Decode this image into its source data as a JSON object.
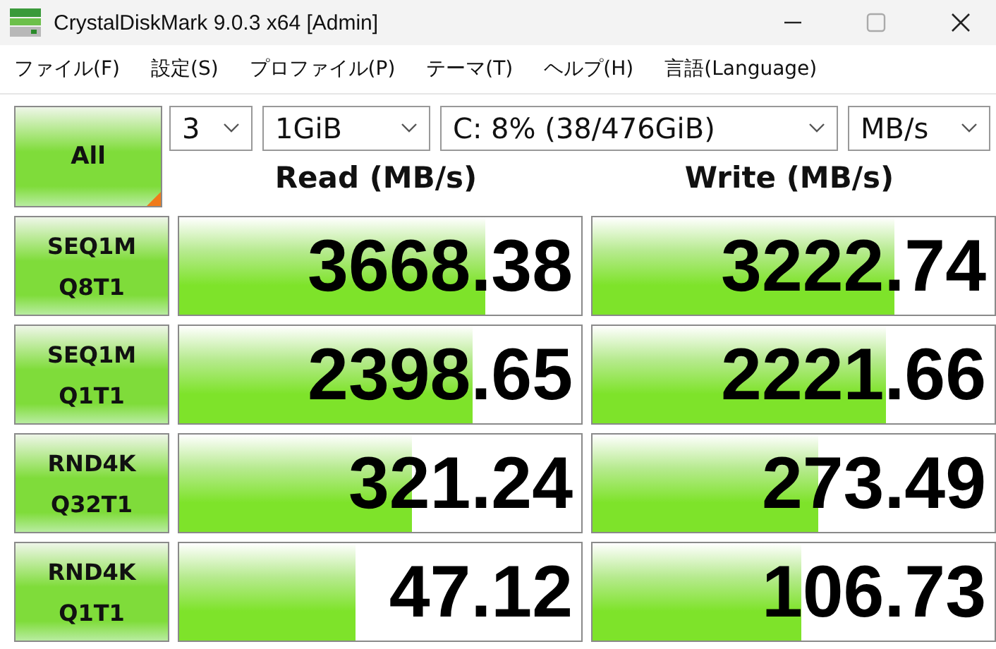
{
  "window": {
    "title": "CrystalDiskMark 9.0.3 x64 [Admin]"
  },
  "menu": [
    "ファイル(F)",
    "設定(S)",
    "プロファイル(P)",
    "テーマ(T)",
    "ヘルプ(H)",
    "言語(Language)"
  ],
  "all_button": {
    "label": "All"
  },
  "selectors": [
    {
      "value": "3"
    },
    {
      "value": "1GiB"
    },
    {
      "value": "C: 8% (38/476GiB)"
    },
    {
      "value": "MB/s"
    }
  ],
  "headers": [
    "Read (MB/s)",
    "Write (MB/s)"
  ],
  "tests": [
    {
      "line1": "SEQ1M",
      "line2": "Q8T1",
      "read": {
        "value": "3668.38",
        "level": 0.76
      },
      "write": {
        "value": "3222.74",
        "level": 0.75
      }
    },
    {
      "line1": "SEQ1M",
      "line2": "Q1T1",
      "read": {
        "value": "2398.65",
        "level": 0.73
      },
      "write": {
        "value": "2221.66",
        "level": 0.73
      }
    },
    {
      "line1": "RND4K",
      "line2": "Q32T1",
      "read": {
        "value": "321.24",
        "level": 0.58
      },
      "write": {
        "value": "273.49",
        "level": 0.56
      }
    },
    {
      "line1": "RND4K",
      "line2": "Q1T1",
      "read": {
        "value": "47.12",
        "level": 0.44
      },
      "write": {
        "value": "106.73",
        "level": 0.52
      }
    }
  ]
}
